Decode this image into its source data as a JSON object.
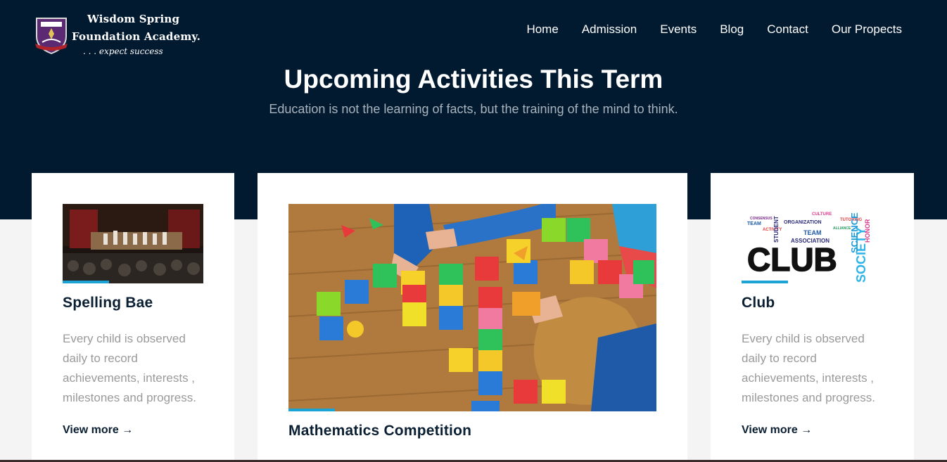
{
  "brand": {
    "line1": "Wisdom Spring",
    "line2": "Foundation Academy.",
    "tagline": ". . . expect success"
  },
  "nav": {
    "items": [
      "Home",
      "Admission",
      "Events",
      "Blog",
      "Contact",
      "Our Propects"
    ]
  },
  "header": {
    "title": "Upcoming Activities This Term",
    "subtitle": "Education is not the learning of facts, but the training of the mind to think."
  },
  "cards": [
    {
      "title": "Spelling Bae",
      "description": "Every child is observed daily to record achievements, interests , milestones and progress.",
      "link": "View more →"
    },
    {
      "title": "Mathematics Competition"
    },
    {
      "title": "Club",
      "description": "Every child is observed daily to record achievements, interests , milestones and progress.",
      "link": "View more →"
    }
  ],
  "colors": {
    "hero_bg": "#021a30",
    "accent": "#1ba3d6",
    "card_title": "#0b1f33",
    "muted_text": "#9a9a9a"
  }
}
